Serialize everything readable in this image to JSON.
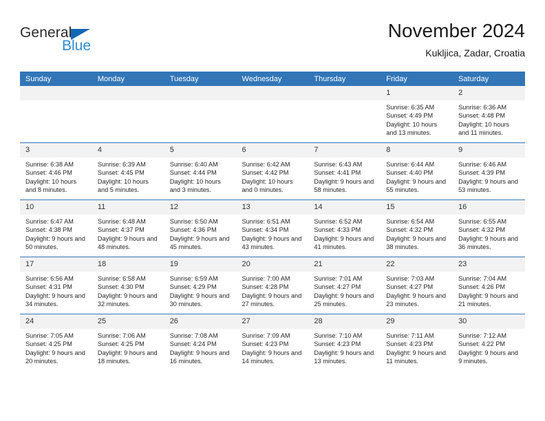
{
  "brand": {
    "name_part1": "General",
    "name_part2": "Blue",
    "triangle_icon": "triangle-icon",
    "color_dark": "#2b2b2b",
    "color_blue": "#2e8bd4"
  },
  "header": {
    "title": "November 2024",
    "subtitle": "Kukljica, Zadar, Croatia"
  },
  "theme": {
    "header_blue": "#3276b8",
    "daynum_gray": "#f2f2f2",
    "text": "#262626"
  },
  "weekday_headers": [
    "Sunday",
    "Monday",
    "Tuesday",
    "Wednesday",
    "Thursday",
    "Friday",
    "Saturday"
  ],
  "weeks": [
    [
      {
        "blank": true,
        "day": "",
        "sunrise": "",
        "sunset": "",
        "daylight": ""
      },
      {
        "blank": true,
        "day": "",
        "sunrise": "",
        "sunset": "",
        "daylight": ""
      },
      {
        "blank": true,
        "day": "",
        "sunrise": "",
        "sunset": "",
        "daylight": ""
      },
      {
        "blank": true,
        "day": "",
        "sunrise": "",
        "sunset": "",
        "daylight": ""
      },
      {
        "blank": true,
        "day": "",
        "sunrise": "",
        "sunset": "",
        "daylight": ""
      },
      {
        "blank": false,
        "day": "1",
        "sunrise": "Sunrise: 6:35 AM",
        "sunset": "Sunset: 4:49 PM",
        "daylight": "Daylight: 10 hours and 13 minutes."
      },
      {
        "blank": false,
        "day": "2",
        "sunrise": "Sunrise: 6:36 AM",
        "sunset": "Sunset: 4:48 PM",
        "daylight": "Daylight: 10 hours and 11 minutes."
      }
    ],
    [
      {
        "blank": false,
        "day": "3",
        "sunrise": "Sunrise: 6:38 AM",
        "sunset": "Sunset: 4:46 PM",
        "daylight": "Daylight: 10 hours and 8 minutes."
      },
      {
        "blank": false,
        "day": "4",
        "sunrise": "Sunrise: 6:39 AM",
        "sunset": "Sunset: 4:45 PM",
        "daylight": "Daylight: 10 hours and 5 minutes."
      },
      {
        "blank": false,
        "day": "5",
        "sunrise": "Sunrise: 6:40 AM",
        "sunset": "Sunset: 4:44 PM",
        "daylight": "Daylight: 10 hours and 3 minutes."
      },
      {
        "blank": false,
        "day": "6",
        "sunrise": "Sunrise: 6:42 AM",
        "sunset": "Sunset: 4:42 PM",
        "daylight": "Daylight: 10 hours and 0 minutes."
      },
      {
        "blank": false,
        "day": "7",
        "sunrise": "Sunrise: 6:43 AM",
        "sunset": "Sunset: 4:41 PM",
        "daylight": "Daylight: 9 hours and 58 minutes."
      },
      {
        "blank": false,
        "day": "8",
        "sunrise": "Sunrise: 6:44 AM",
        "sunset": "Sunset: 4:40 PM",
        "daylight": "Daylight: 9 hours and 55 minutes."
      },
      {
        "blank": false,
        "day": "9",
        "sunrise": "Sunrise: 6:46 AM",
        "sunset": "Sunset: 4:39 PM",
        "daylight": "Daylight: 9 hours and 53 minutes."
      }
    ],
    [
      {
        "blank": false,
        "day": "10",
        "sunrise": "Sunrise: 6:47 AM",
        "sunset": "Sunset: 4:38 PM",
        "daylight": "Daylight: 9 hours and 50 minutes."
      },
      {
        "blank": false,
        "day": "11",
        "sunrise": "Sunrise: 6:48 AM",
        "sunset": "Sunset: 4:37 PM",
        "daylight": "Daylight: 9 hours and 48 minutes."
      },
      {
        "blank": false,
        "day": "12",
        "sunrise": "Sunrise: 6:50 AM",
        "sunset": "Sunset: 4:36 PM",
        "daylight": "Daylight: 9 hours and 45 minutes."
      },
      {
        "blank": false,
        "day": "13",
        "sunrise": "Sunrise: 6:51 AM",
        "sunset": "Sunset: 4:34 PM",
        "daylight": "Daylight: 9 hours and 43 minutes."
      },
      {
        "blank": false,
        "day": "14",
        "sunrise": "Sunrise: 6:52 AM",
        "sunset": "Sunset: 4:33 PM",
        "daylight": "Daylight: 9 hours and 41 minutes."
      },
      {
        "blank": false,
        "day": "15",
        "sunrise": "Sunrise: 6:54 AM",
        "sunset": "Sunset: 4:32 PM",
        "daylight": "Daylight: 9 hours and 38 minutes."
      },
      {
        "blank": false,
        "day": "16",
        "sunrise": "Sunrise: 6:55 AM",
        "sunset": "Sunset: 4:32 PM",
        "daylight": "Daylight: 9 hours and 36 minutes."
      }
    ],
    [
      {
        "blank": false,
        "day": "17",
        "sunrise": "Sunrise: 6:56 AM",
        "sunset": "Sunset: 4:31 PM",
        "daylight": "Daylight: 9 hours and 34 minutes."
      },
      {
        "blank": false,
        "day": "18",
        "sunrise": "Sunrise: 6:58 AM",
        "sunset": "Sunset: 4:30 PM",
        "daylight": "Daylight: 9 hours and 32 minutes."
      },
      {
        "blank": false,
        "day": "19",
        "sunrise": "Sunrise: 6:59 AM",
        "sunset": "Sunset: 4:29 PM",
        "daylight": "Daylight: 9 hours and 30 minutes."
      },
      {
        "blank": false,
        "day": "20",
        "sunrise": "Sunrise: 7:00 AM",
        "sunset": "Sunset: 4:28 PM",
        "daylight": "Daylight: 9 hours and 27 minutes."
      },
      {
        "blank": false,
        "day": "21",
        "sunrise": "Sunrise: 7:01 AM",
        "sunset": "Sunset: 4:27 PM",
        "daylight": "Daylight: 9 hours and 25 minutes."
      },
      {
        "blank": false,
        "day": "22",
        "sunrise": "Sunrise: 7:03 AM",
        "sunset": "Sunset: 4:27 PM",
        "daylight": "Daylight: 9 hours and 23 minutes."
      },
      {
        "blank": false,
        "day": "23",
        "sunrise": "Sunrise: 7:04 AM",
        "sunset": "Sunset: 4:26 PM",
        "daylight": "Daylight: 9 hours and 21 minutes."
      }
    ],
    [
      {
        "blank": false,
        "day": "24",
        "sunrise": "Sunrise: 7:05 AM",
        "sunset": "Sunset: 4:25 PM",
        "daylight": "Daylight: 9 hours and 20 minutes."
      },
      {
        "blank": false,
        "day": "25",
        "sunrise": "Sunrise: 7:06 AM",
        "sunset": "Sunset: 4:25 PM",
        "daylight": "Daylight: 9 hours and 18 minutes."
      },
      {
        "blank": false,
        "day": "26",
        "sunrise": "Sunrise: 7:08 AM",
        "sunset": "Sunset: 4:24 PM",
        "daylight": "Daylight: 9 hours and 16 minutes."
      },
      {
        "blank": false,
        "day": "27",
        "sunrise": "Sunrise: 7:09 AM",
        "sunset": "Sunset: 4:23 PM",
        "daylight": "Daylight: 9 hours and 14 minutes."
      },
      {
        "blank": false,
        "day": "28",
        "sunrise": "Sunrise: 7:10 AM",
        "sunset": "Sunset: 4:23 PM",
        "daylight": "Daylight: 9 hours and 13 minutes."
      },
      {
        "blank": false,
        "day": "29",
        "sunrise": "Sunrise: 7:11 AM",
        "sunset": "Sunset: 4:23 PM",
        "daylight": "Daylight: 9 hours and 11 minutes."
      },
      {
        "blank": false,
        "day": "30",
        "sunrise": "Sunrise: 7:12 AM",
        "sunset": "Sunset: 4:22 PM",
        "daylight": "Daylight: 9 hours and 9 minutes."
      }
    ]
  ]
}
